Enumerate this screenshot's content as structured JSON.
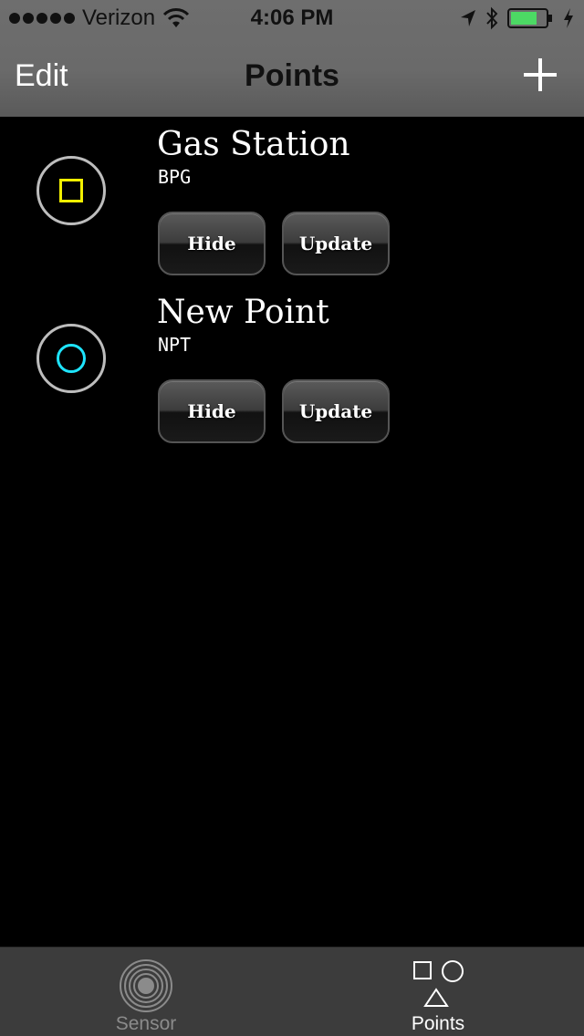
{
  "status_bar": {
    "carrier": "Verizon",
    "time": "4:06 PM",
    "signal_icon": "signal-dots-icon",
    "wifi_icon": "wifi-icon",
    "location_icon": "location-arrow-icon",
    "bluetooth_icon": "bluetooth-icon",
    "battery_icon": "battery-icon",
    "charging_icon": "charging-bolt-icon",
    "battery_color": "#4cd964"
  },
  "nav": {
    "left_label": "Edit",
    "title": "Points",
    "right_icon": "plus-icon"
  },
  "points": [
    {
      "name": "Gas Station",
      "code": "BPG",
      "shape": "square",
      "shape_color": "#f2ef00",
      "hide_label": "Hide",
      "update_label": "Update"
    },
    {
      "name": "New Point",
      "code": "NPT",
      "shape": "circle",
      "shape_color": "#1ee4ff",
      "hide_label": "Hide",
      "update_label": "Update"
    }
  ],
  "tabs": [
    {
      "label": "Sensor",
      "icon": "sensor-rings-icon",
      "selected": false
    },
    {
      "label": "Points",
      "icon": "shapes-icon",
      "selected": true
    }
  ]
}
